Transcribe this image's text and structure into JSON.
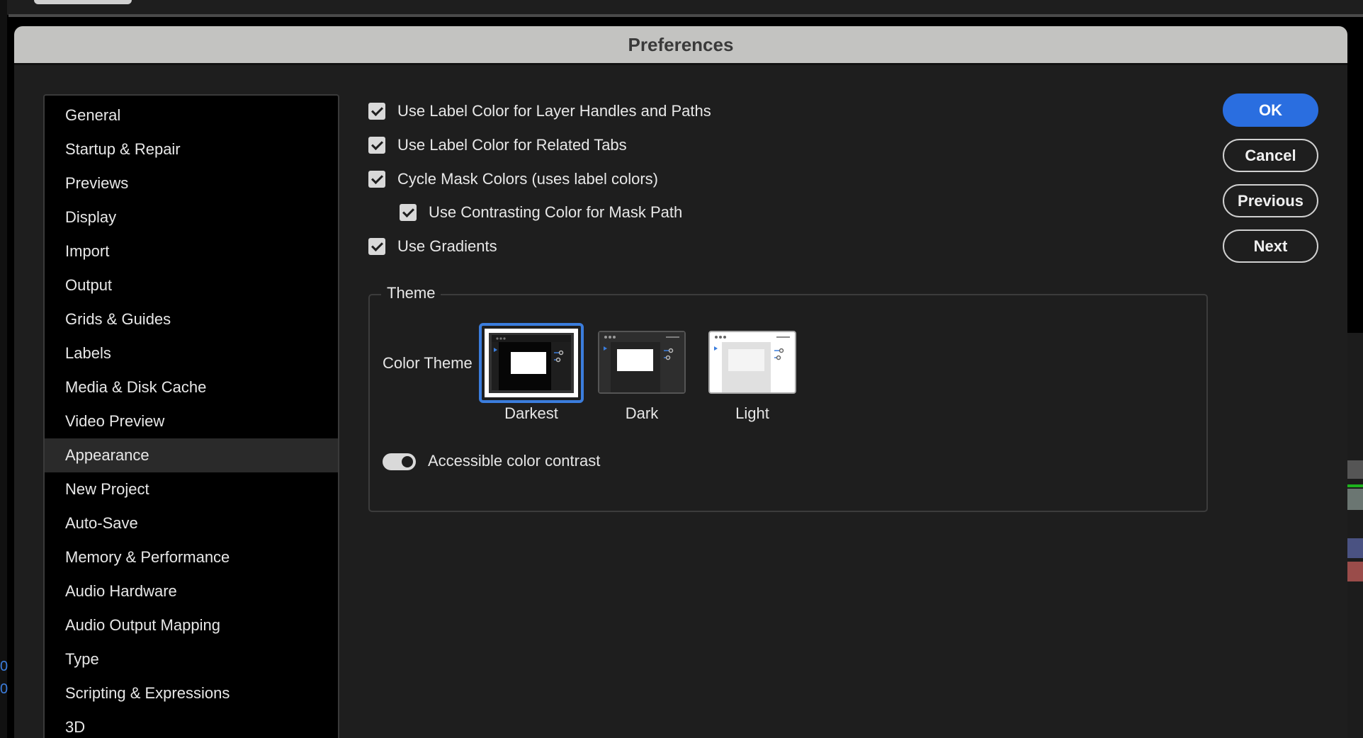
{
  "window": {
    "title": "Preferences"
  },
  "sidebar": {
    "items": [
      {
        "label": "General"
      },
      {
        "label": "Startup & Repair"
      },
      {
        "label": "Previews"
      },
      {
        "label": "Display"
      },
      {
        "label": "Import"
      },
      {
        "label": "Output"
      },
      {
        "label": "Grids & Guides"
      },
      {
        "label": "Labels"
      },
      {
        "label": "Media & Disk Cache"
      },
      {
        "label": "Video Preview"
      },
      {
        "label": "Appearance",
        "selected": true
      },
      {
        "label": "New Project"
      },
      {
        "label": "Auto-Save"
      },
      {
        "label": "Memory & Performance"
      },
      {
        "label": "Audio Hardware"
      },
      {
        "label": "Audio Output Mapping"
      },
      {
        "label": "Type"
      },
      {
        "label": "Scripting & Expressions"
      },
      {
        "label": "3D"
      }
    ]
  },
  "options": [
    {
      "label": "Use Label Color for Layer Handles and Paths",
      "checked": true
    },
    {
      "label": "Use Label Color for Related Tabs",
      "checked": true
    },
    {
      "label": "Cycle Mask Colors (uses label colors)",
      "checked": true
    },
    {
      "label": "Use Contrasting Color for Mask Path",
      "checked": true
    },
    {
      "label": "Use Gradients",
      "checked": true
    }
  ],
  "theme": {
    "legend": "Theme",
    "color_theme_label": "Color Theme",
    "selected": "Darkest",
    "options": [
      {
        "label": "Darkest"
      },
      {
        "label": "Dark"
      },
      {
        "label": "Light"
      }
    ],
    "accessible_contrast": {
      "label": "Accessible color contrast",
      "on": true
    }
  },
  "buttons": {
    "ok": "OK",
    "cancel": "Cancel",
    "previous": "Previous",
    "next": "Next"
  },
  "colors": {
    "accent": "#2a6ee0",
    "titlebar": "#c3c3c1",
    "dialog_bg": "#1e1e1e"
  }
}
